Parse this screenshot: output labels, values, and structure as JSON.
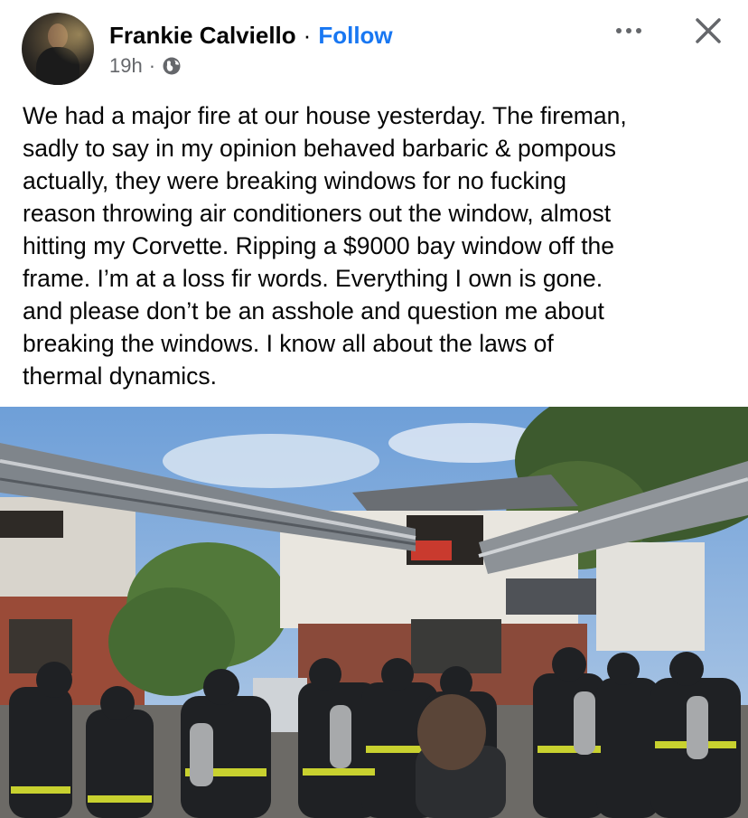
{
  "post": {
    "author": "Frankie Calviello",
    "separator": "·",
    "follow_label": "Follow",
    "timestamp": "19h",
    "meta_separator": "·",
    "privacy_icon": "globe-icon",
    "more_icon": "more-options-icon",
    "close_icon": "close-icon",
    "text": "We had a major fire at our house yesterday. The fireman,\nsadly to say in my opinion behaved barbaric  & pompous\nactually, they were breaking windows for no fucking\nreason throwing air conditioners out the window, almost\nhitting my Corvette. Ripping a $9000 bay window off the\nframe. I’m at a  loss fir  words. Everything I own is gone.\nand please don’t be an asshole and question me about\nbreaking the windows. I know all about the laws of\nthermal dynamics."
  },
  "colors": {
    "follow": "#1877f2",
    "secondary_text": "#65676b",
    "primary_text": "#050505"
  }
}
